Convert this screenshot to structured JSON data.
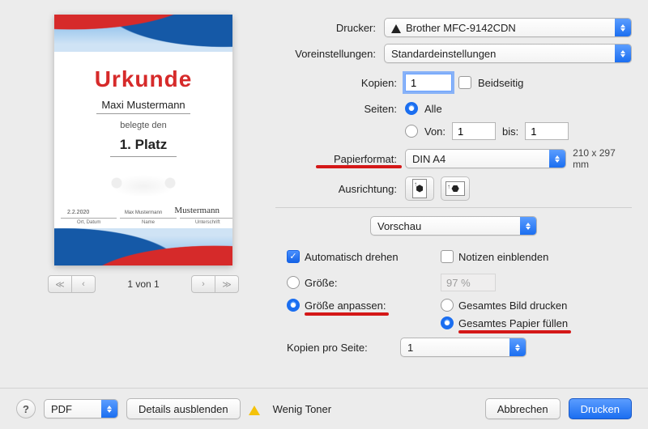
{
  "preview": {
    "doc_title": "Urkunde",
    "name": "Maxi Mustermann",
    "belegte": "belegte den",
    "platz": "1. Platz",
    "date": "2.2.2020",
    "sig_name": "Max Mustermann",
    "sig_script": "Mustermann",
    "sig_labels": {
      "a": "Ort, Datum",
      "b": "Name",
      "c": "Unterschrift"
    }
  },
  "pager": {
    "label": "1 von 1",
    "first": "≪",
    "prev": "‹",
    "next": "›",
    "last": "≫"
  },
  "labels": {
    "printer": "Drucker:",
    "presets": "Voreinstellungen:",
    "copies": "Kopien:",
    "twosided": "Beidseitig",
    "pages": "Seiten:",
    "pages_all": "Alle",
    "pages_from": "Von:",
    "pages_to": "bis:",
    "paper": "Papierformat:",
    "paper_dim": "210 x 297 mm",
    "orientation": "Ausrichtung:",
    "section": "Vorschau",
    "auto_rotate": "Automatisch drehen",
    "show_notes": "Notizen einblenden",
    "scale_fixed": "Größe:",
    "scale_fit": "Größe anpassen:",
    "fit_image": "Gesamtes Bild drucken",
    "fill_paper": "Gesamtes Papier füllen",
    "copies_per_page": "Kopien pro Seite:"
  },
  "values": {
    "printer": "Brother MFC-9142CDN",
    "presets": "Standardeinstellungen",
    "copies": "1",
    "pages_from": "1",
    "pages_to": "1",
    "paper": "DIN A4",
    "scale_pct": "97 %",
    "copies_per_page": "1"
  },
  "footer": {
    "pdf": "PDF",
    "details": "Details ausblenden",
    "low_toner": "Wenig Toner",
    "cancel": "Abbrechen",
    "print": "Drucken"
  }
}
